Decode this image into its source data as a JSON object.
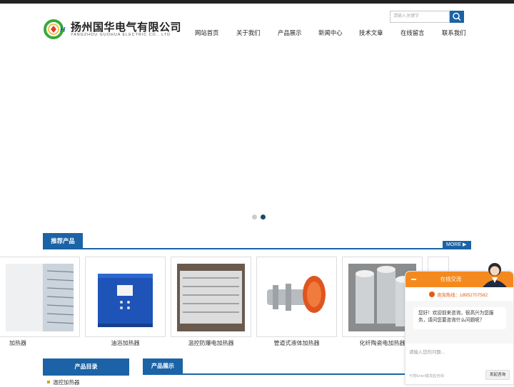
{
  "brand": {
    "name": "扬州国华电气有限公司",
    "english": "YANGZHOU GUOHUA ELECTRIC CO., LTD",
    "mark_text": "GH",
    "colors": {
      "primary": "#1b63a6",
      "logo_green": "#3aa83c",
      "accent_orange": "#f48a1f"
    }
  },
  "search": {
    "placeholder": "请输入关键字",
    "icon": "search-icon"
  },
  "nav": [
    "网站首页",
    "关于我们",
    "产品展示",
    "新闻中心",
    "技术文章",
    "在线留言",
    "联系我们"
  ],
  "slider": {
    "dots": 2,
    "active_index": 1
  },
  "recommended": {
    "title": "推荐产品",
    "more_label": "MORE ▶",
    "items": [
      {
        "name": "加热器",
        "icon": "heater-panel-icon"
      },
      {
        "name": "油浴加热器",
        "icon": "control-cabinet-icon"
      },
      {
        "name": "温控防爆电加热器",
        "icon": "finned-heater-icon"
      },
      {
        "name": "管道式液体加热器",
        "icon": "pipeline-heater-icon"
      },
      {
        "name": "化纤陶瓷电加热器",
        "icon": "ceramic-band-heater-icon"
      }
    ]
  },
  "sidebar": {
    "title": "产品目录",
    "items": [
      "温控加热器"
    ]
  },
  "main": {
    "title": "产品展示"
  },
  "chat": {
    "title": "在线交流",
    "hotline_label": "咨询热线：18952707582",
    "welcome": "您好！欢迎前来咨询，很高兴为您服务，请问您要咨询什么问题呢？",
    "input_placeholder": "请输入您的问题...",
    "hint": "可按Enter键发起咨询",
    "send_label": "发起咨询"
  }
}
